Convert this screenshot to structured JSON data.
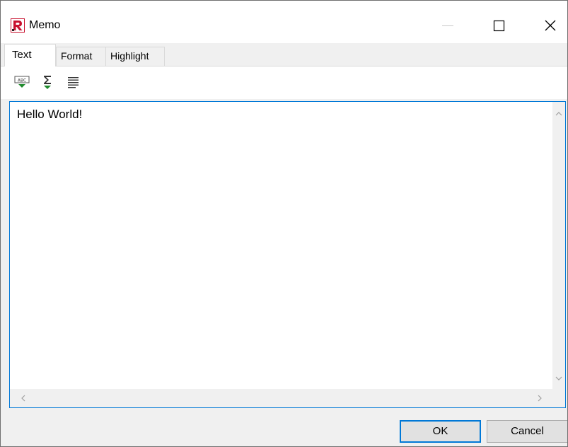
{
  "window": {
    "title": "Memo",
    "icon": "fastreport-r-icon",
    "controls": [
      "minimize-icon",
      "maximize-icon",
      "close-icon"
    ]
  },
  "tabs": [
    {
      "label": "Text",
      "active": true
    },
    {
      "label": "Format",
      "active": false
    },
    {
      "label": "Highlight",
      "active": false
    }
  ],
  "toolbar": {
    "items": [
      {
        "icon": "spell-check-icon",
        "accent": "#1f8a2c"
      },
      {
        "icon": "sum-icon",
        "accent": "#1f8a2c"
      },
      {
        "icon": "align-justify-icon"
      }
    ]
  },
  "memo": {
    "text": "Hello World!"
  },
  "buttons": {
    "ok_label": "OK",
    "cancel_label": "Cancel"
  },
  "colors": {
    "focus_border": "#0078d7",
    "app_icon_red": "#c8102e"
  }
}
